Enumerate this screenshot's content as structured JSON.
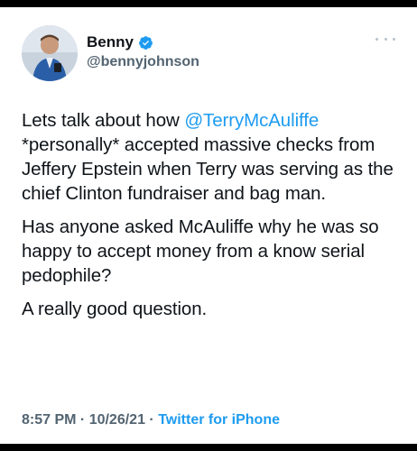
{
  "author": {
    "display_name": "Benny",
    "handle": "@bennyjohnson",
    "verified": true
  },
  "icons": {
    "verified": "verified-badge-icon",
    "more": "more-options-icon"
  },
  "tweet": {
    "para1_before": "Lets talk about how ",
    "mention": "@TerryMcAuliffe",
    "para1_after": " *personally* accepted massive checks from Jeffery Epstein when Terry was serving as the chief Clinton fundraiser and bag man.",
    "para2": "Has anyone asked McAuliffe why he was so happy to accept money from a know serial pedophile?",
    "para3": "A really good question."
  },
  "meta": {
    "time": "8:57 PM",
    "separator1": " · ",
    "date": "10/26/21",
    "separator2": " · ",
    "source": "Twitter for iPhone"
  },
  "colors": {
    "accent": "#1d9bf0",
    "text": "#0f1419",
    "muted": "#536471"
  }
}
